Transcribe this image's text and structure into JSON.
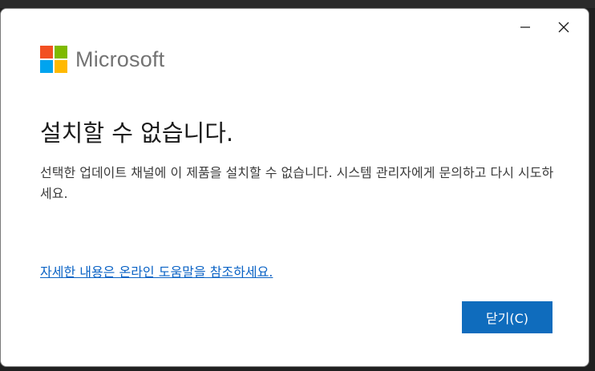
{
  "window": {
    "minimize_icon": "minimize-icon",
    "close_icon": "close-icon"
  },
  "brand": {
    "name": "Microsoft",
    "logo_colors": [
      "#f25022",
      "#7fba00",
      "#00a4ef",
      "#ffb900"
    ]
  },
  "dialog": {
    "heading": "설치할 수 없습니다.",
    "message": "선택한 업데이트 채널에 이 제품을 설치할 수 없습니다. 시스템 관리자에게 문의하고 다시 시도하세요.",
    "help_link": "자세한 내용은 온라인 도움말을 참조하세요.",
    "close_button_label": "닫기(C)"
  },
  "colors": {
    "accent": "#0f6cbd",
    "link": "#0b63c5"
  }
}
